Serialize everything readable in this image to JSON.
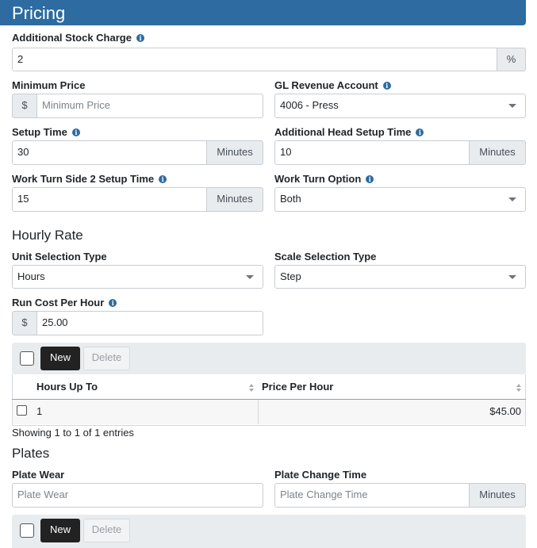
{
  "header": {
    "title": "Pricing"
  },
  "additional_stock_charge": {
    "label": "Additional Stock Charge",
    "value": "2",
    "suffix": "%"
  },
  "minimum_price": {
    "label": "Minimum Price",
    "prefix": "$",
    "placeholder": "Minimum Price"
  },
  "gl_revenue_account": {
    "label": "GL Revenue Account",
    "value": "4006 - Press"
  },
  "setup_time": {
    "label": "Setup Time",
    "value": "30",
    "suffix": "Minutes"
  },
  "additional_head_setup_time": {
    "label": "Additional Head Setup Time",
    "value": "10",
    "suffix": "Minutes"
  },
  "work_turn_side2_setup_time": {
    "label": "Work Turn Side 2 Setup Time",
    "value": "15",
    "suffix": "Minutes"
  },
  "work_turn_option": {
    "label": "Work Turn Option",
    "value": "Both"
  },
  "hourly_rate": {
    "heading": "Hourly Rate",
    "unit_selection_type": {
      "label": "Unit Selection Type",
      "value": "Hours"
    },
    "scale_selection_type": {
      "label": "Scale Selection Type",
      "value": "Step"
    },
    "run_cost_per_hour": {
      "label": "Run Cost Per Hour",
      "prefix": "$",
      "value": "25.00"
    },
    "toolbar": {
      "new_label": "New",
      "delete_label": "Delete"
    },
    "table": {
      "columns": [
        "Hours Up To",
        "Price Per Hour"
      ],
      "rows": [
        {
          "hours_up_to": "1",
          "price_per_hour": "$45.00"
        }
      ]
    },
    "info_text": "Showing 1 to 1 of 1 entries"
  },
  "plates": {
    "heading": "Plates",
    "plate_wear": {
      "label": "Plate Wear",
      "placeholder": "Plate Wear"
    },
    "plate_change_time": {
      "label": "Plate Change Time",
      "placeholder": "Plate Change Time",
      "suffix": "Minutes"
    },
    "toolbar": {
      "new_label": "New",
      "delete_label": "Delete"
    }
  },
  "icons": {
    "info": "info-icon",
    "dropdown": "chevron-down-icon",
    "sort": "sort-icon"
  },
  "colors": {
    "header_bg": "#2d6ba0",
    "new_button_bg": "#222222",
    "toolbar_bg": "#e9ecef"
  }
}
